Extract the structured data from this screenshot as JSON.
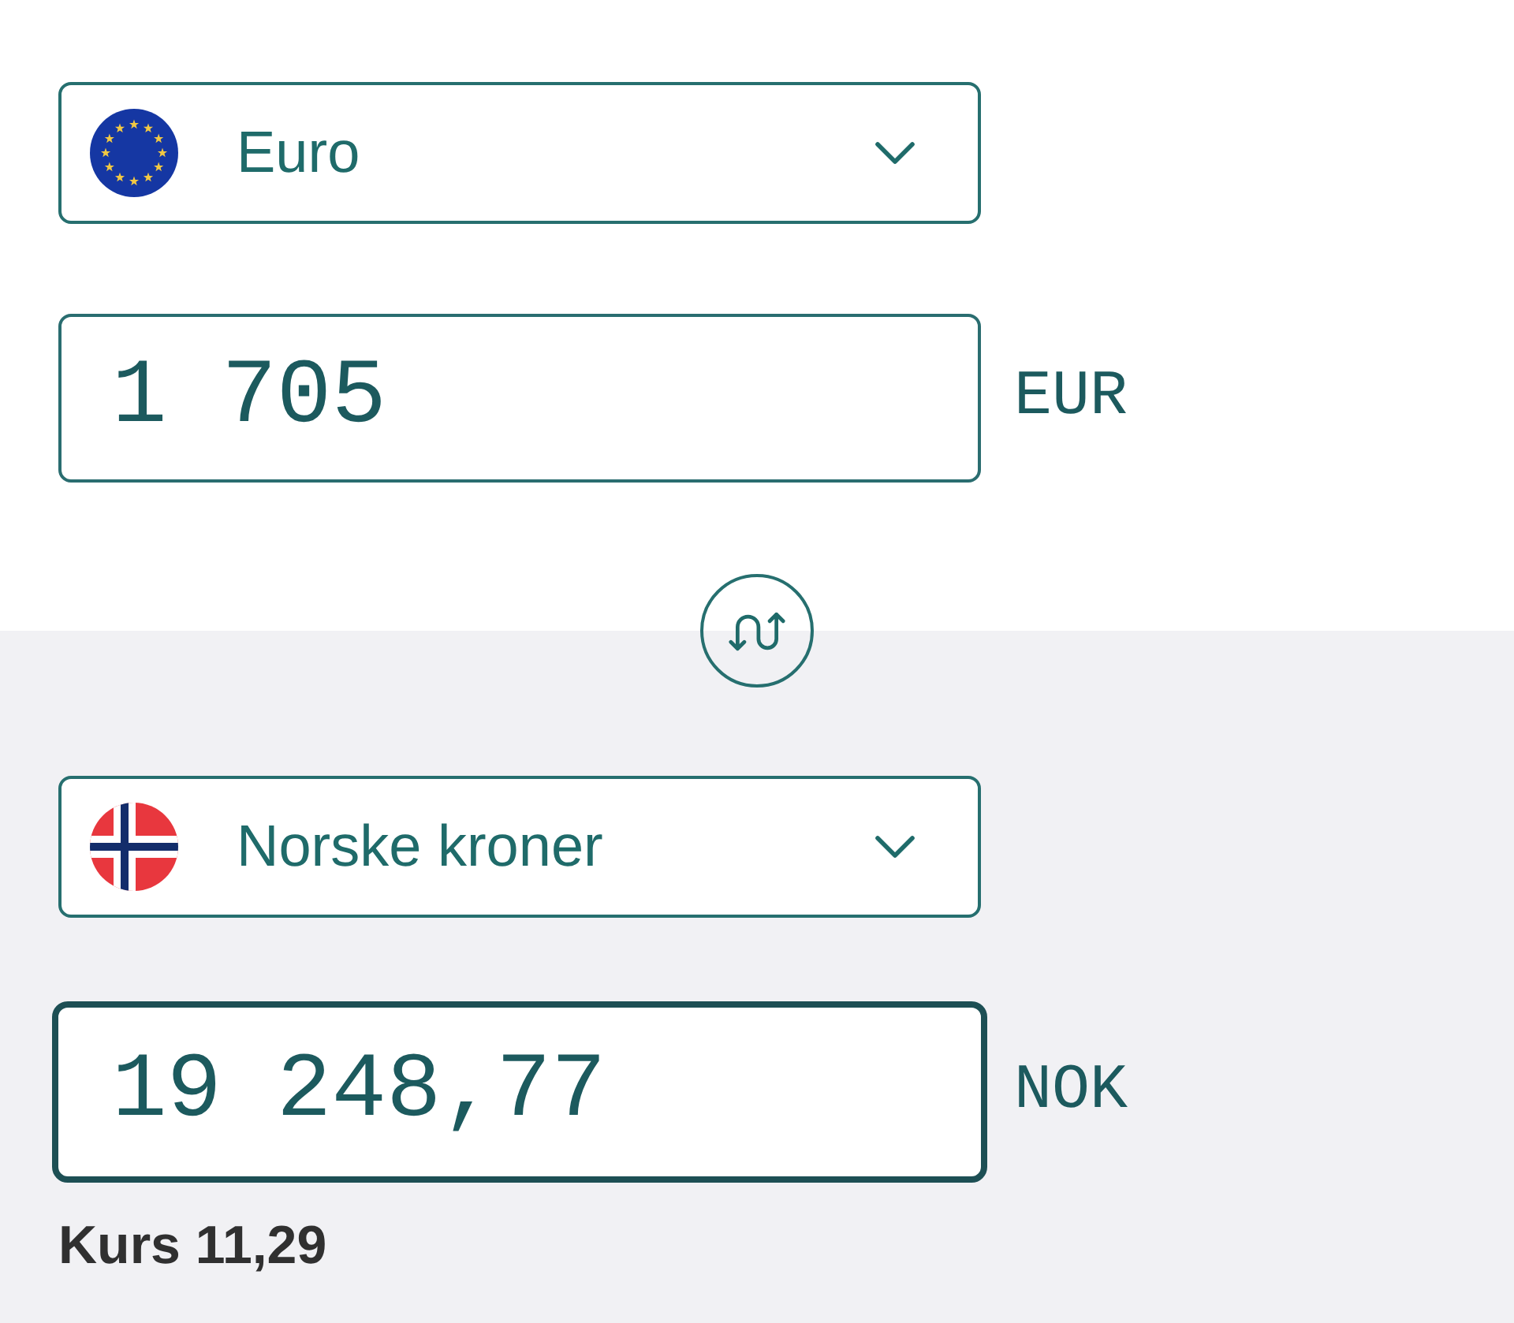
{
  "sides": [
    {
      "currency": {
        "kind": "eu",
        "name": "Euro"
      },
      "amount": {
        "value": "1 705",
        "focused": false
      },
      "code": "EUR"
    },
    {
      "currency": {
        "kind": "no",
        "name": "Norske kroner"
      },
      "amount": {
        "value": "19 248,77",
        "focused": true
      },
      "code": "NOK"
    }
  ],
  "rate": "Kurs 11,29"
}
